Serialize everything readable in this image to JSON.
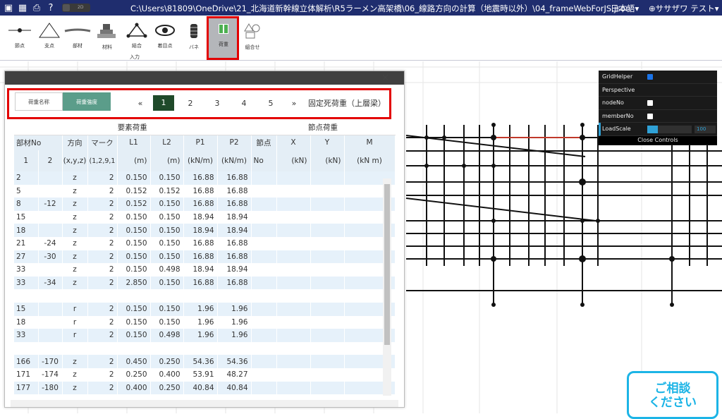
{
  "titlebar": {
    "path": "C:\\Users\\81809\\OneDrive\\21_北海道新幹線立体解析\\R5ラーメン高架橋\\06_線路方向の計算（地震時以外）\\04_frameWebForJS.json",
    "toggle_label": "2D",
    "language": "日本語▾",
    "user": "ササザワ テスト▾",
    "icons": [
      "file-menu-icon",
      "calculator-icon",
      "print-icon",
      "help-icon"
    ]
  },
  "ribbon": {
    "items": [
      {
        "label": "節点",
        "icon": "node-icon"
      },
      {
        "label": "支点",
        "icon": "support-icon"
      },
      {
        "label": "部材",
        "icon": "member-icon"
      },
      {
        "label": "材料",
        "icon": "material-icon"
      },
      {
        "label": "結合",
        "icon": "joint-icon"
      },
      {
        "label": "着目点",
        "icon": "eye-icon"
      },
      {
        "label": "バネ",
        "icon": "spring-icon"
      },
      {
        "label": "荷重",
        "icon": "load-icon"
      },
      {
        "label": "組合せ",
        "icon": "combination-icon"
      }
    ],
    "group_label": "入力",
    "active": "荷重"
  },
  "panel": {
    "close": "×",
    "tabs": [
      {
        "label": "荷重名称",
        "active": false
      },
      {
        "label": "荷重強度",
        "active": true
      }
    ],
    "pager": {
      "prev": "«",
      "pages": [
        "1",
        "2",
        "3",
        "4",
        "5"
      ],
      "current": "1",
      "next": "»"
    },
    "load_name": "固定死荷重（上層梁）",
    "table": {
      "group_headers": [
        "要素荷重",
        "節点荷重"
      ],
      "headers1": [
        "部材No",
        "方向",
        "マーク",
        "L1",
        "L2",
        "P1",
        "P2",
        "節点",
        "X",
        "Y",
        "M"
      ],
      "headers2": [
        "1",
        "2",
        "(x,y,z)",
        "(1,2,9,1",
        "(m)",
        "(m)",
        "(kN/m)",
        "(kN/m)",
        "No",
        "(kN)",
        "(kN)",
        "(kN m)"
      ],
      "rows": [
        [
          "2",
          "",
          "z",
          "2",
          "0.150",
          "0.150",
          "16.88",
          "16.88"
        ],
        [
          "5",
          "",
          "z",
          "2",
          "0.152",
          "0.152",
          "16.88",
          "16.88"
        ],
        [
          "8",
          "-12",
          "z",
          "2",
          "0.152",
          "0.150",
          "16.88",
          "16.88"
        ],
        [
          "15",
          "",
          "z",
          "2",
          "0.150",
          "0.150",
          "18.94",
          "18.94"
        ],
        [
          "18",
          "",
          "z",
          "2",
          "0.150",
          "0.150",
          "18.94",
          "18.94"
        ],
        [
          "21",
          "-24",
          "z",
          "2",
          "0.150",
          "0.150",
          "16.88",
          "16.88"
        ],
        [
          "27",
          "-30",
          "z",
          "2",
          "0.150",
          "0.150",
          "16.88",
          "16.88"
        ],
        [
          "33",
          "",
          "z",
          "2",
          "0.150",
          "0.498",
          "18.94",
          "18.94"
        ],
        [
          "33",
          "-34",
          "z",
          "2",
          "2.850",
          "0.150",
          "16.88",
          "16.88"
        ],
        [
          "",
          "",
          "",
          "",
          "",
          "",
          "",
          ""
        ],
        [
          "15",
          "",
          "r",
          "2",
          "0.150",
          "0.150",
          "1.96",
          "1.96"
        ],
        [
          "18",
          "",
          "r",
          "2",
          "0.150",
          "0.150",
          "1.96",
          "1.96"
        ],
        [
          "33",
          "",
          "r",
          "2",
          "0.150",
          "0.498",
          "1.96",
          "1.96"
        ],
        [
          "",
          "",
          "",
          "",
          "",
          "",
          "",
          ""
        ],
        [
          "166",
          "-170",
          "z",
          "2",
          "0.450",
          "0.250",
          "54.36",
          "54.36"
        ],
        [
          "171",
          "-174",
          "z",
          "2",
          "0.250",
          "0.400",
          "53.91",
          "48.27"
        ],
        [
          "177",
          "-180",
          "z",
          "2",
          "0.400",
          "0.250",
          "40.84",
          "40.84"
        ]
      ]
    }
  },
  "controls": {
    "rows": [
      {
        "label": "GridHelper",
        "checked": true
      },
      {
        "label": "Perspective"
      },
      {
        "label": "nodeNo",
        "checked": false
      },
      {
        "label": "memberNo",
        "checked": false
      },
      {
        "label": "LoadScale",
        "value": "100",
        "level": 0.24
      }
    ],
    "close_label": "Close Controls"
  },
  "consult": {
    "line1": "ご相談",
    "line2": "ください"
  }
}
